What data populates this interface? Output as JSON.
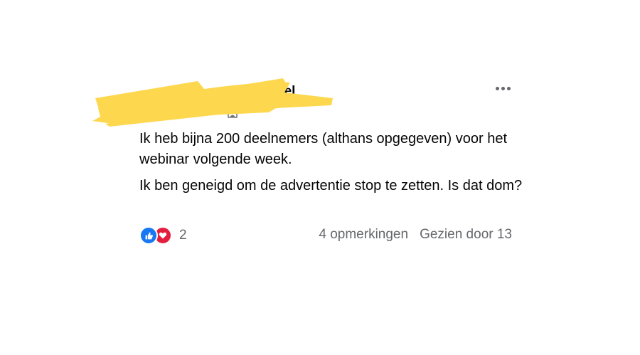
{
  "post": {
    "author_name_visible": "nel",
    "body": [
      "Ik heb bijna 200 deelnemers (althans opgegeven) voor het webinar volgende week.",
      "Ik ben geneigd om de advertentie stop te zetten. Is dat dom?"
    ],
    "reactions": {
      "icons": [
        "like-icon",
        "love-icon"
      ],
      "count": "2"
    },
    "comments_label": "4 opmerkingen",
    "seen_by_label": "Gezien door 13"
  },
  "colors": {
    "redaction_yellow": "#fdd84f",
    "like_blue": "#1877f2",
    "love_red": "#e41e3f",
    "secondary_text": "#65676b"
  }
}
